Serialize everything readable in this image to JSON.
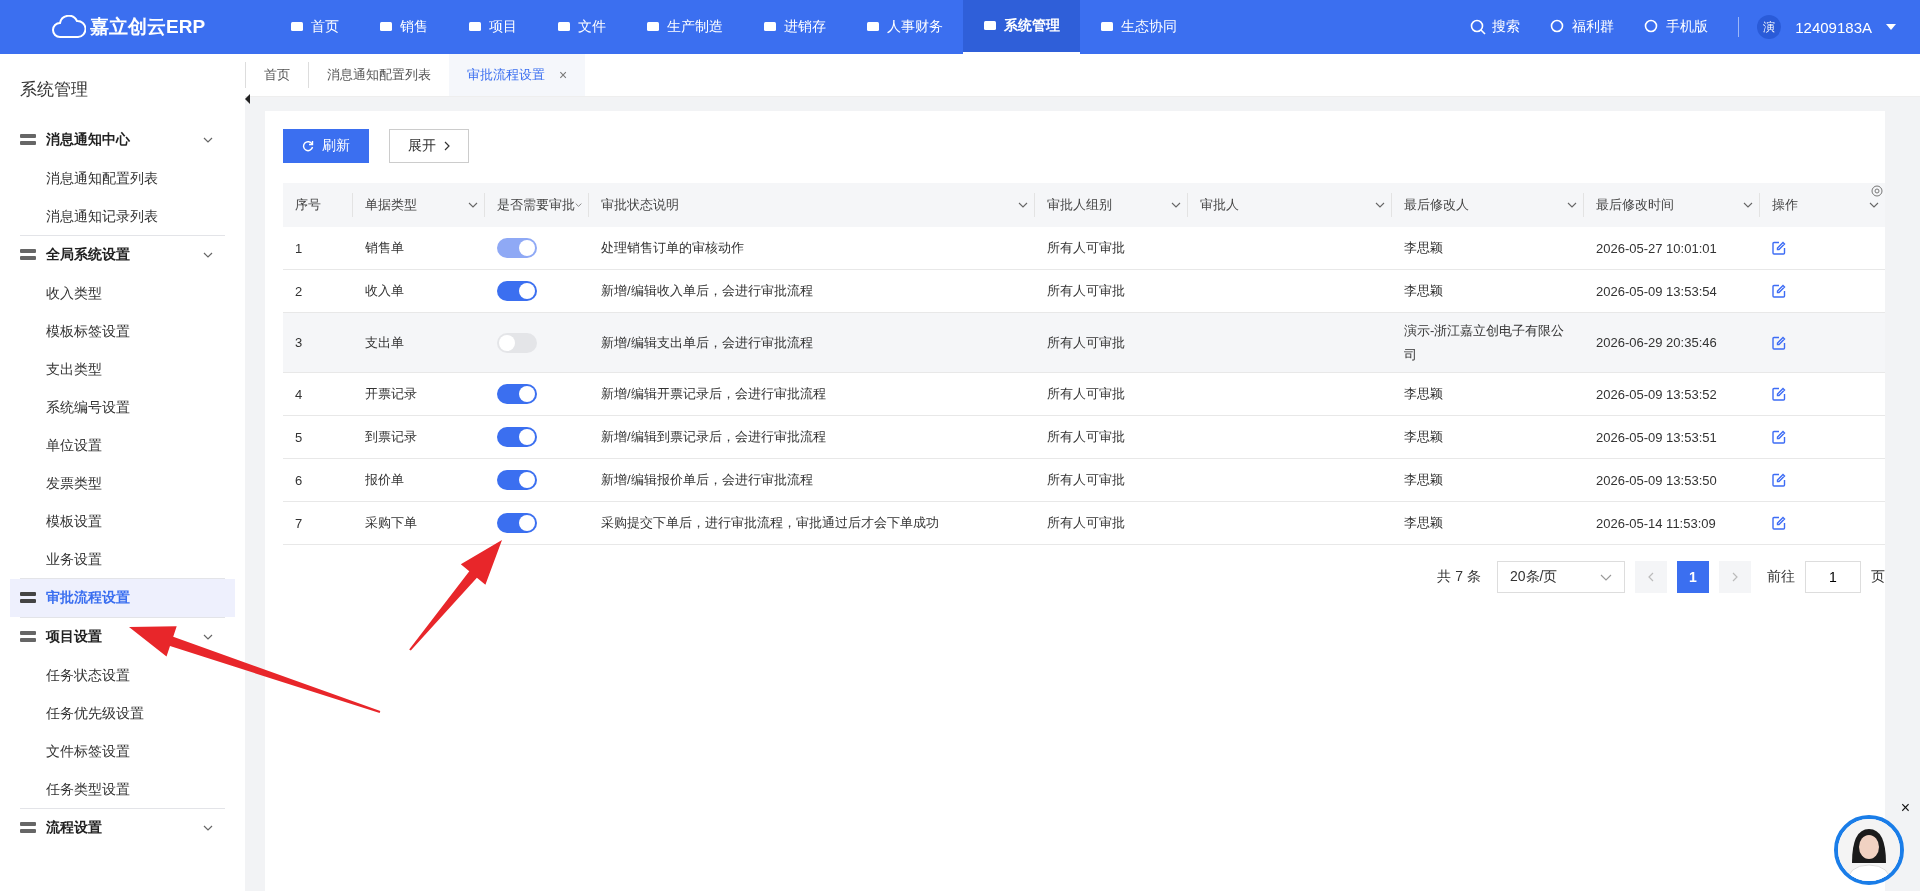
{
  "topbar": {
    "logo": "嘉立创云ERP",
    "nav": [
      {
        "label": "首页",
        "selected": false
      },
      {
        "label": "销售",
        "selected": false
      },
      {
        "label": "项目",
        "selected": false
      },
      {
        "label": "文件",
        "selected": false
      },
      {
        "label": "生产制造",
        "selected": false
      },
      {
        "label": "进销存",
        "selected": false
      },
      {
        "label": "人事财务",
        "selected": false
      },
      {
        "label": "系统管理",
        "selected": true
      },
      {
        "label": "生态协同",
        "selected": false
      }
    ],
    "tools": [
      "搜索",
      "福利群",
      "手机版"
    ],
    "avatar": "演",
    "user": "12409183A"
  },
  "sidebar": {
    "title": "系统管理",
    "items": [
      {
        "kind": "group",
        "label": "消息通知中心",
        "expanded": true,
        "selected": false,
        "children": [
          {
            "label": "消息通知配置列表",
            "selected": false
          },
          {
            "label": "消息通知记录列表",
            "selected": false
          }
        ]
      },
      {
        "kind": "group",
        "label": "全局系统设置",
        "expanded": true,
        "selected": false,
        "children": [
          {
            "label": "收入类型",
            "selected": false
          },
          {
            "label": "模板标签设置",
            "selected": false
          },
          {
            "label": "支出类型",
            "selected": false
          },
          {
            "label": "系统编号设置",
            "selected": false
          },
          {
            "label": "单位设置",
            "selected": false
          },
          {
            "label": "发票类型",
            "selected": false
          },
          {
            "label": "模板设置",
            "selected": false
          },
          {
            "label": "业务设置",
            "selected": false
          }
        ]
      },
      {
        "kind": "item",
        "label": "审批流程设置",
        "selected": true
      },
      {
        "kind": "group",
        "label": "项目设置",
        "expanded": true,
        "selected": false,
        "children": [
          {
            "label": "任务状态设置",
            "selected": false
          },
          {
            "label": "任务优先级设置",
            "selected": false
          },
          {
            "label": "文件标签设置",
            "selected": false
          },
          {
            "label": "任务类型设置",
            "selected": false
          }
        ]
      },
      {
        "kind": "group",
        "label": "流程设置",
        "expanded": true,
        "selected": false
      }
    ]
  },
  "tabs": [
    {
      "label": "首页",
      "selected": false
    },
    {
      "label": "消息通知配置列表",
      "selected": false
    },
    {
      "label": "审批流程设置",
      "selected": true,
      "closable": true,
      "close": "×"
    }
  ],
  "toolbar": {
    "refresh": "刷新",
    "expand": "展开"
  },
  "table": {
    "columns": [
      "序号",
      "单据类型",
      "是否需要审批",
      "审批状态说明",
      "审批人组别",
      "审批人",
      "最后修改人",
      "最后修改时间",
      "操作"
    ],
    "rows": [
      {
        "no": "1",
        "type": "销售单",
        "on": true,
        "disabled": true,
        "desc": "处理销售订单的审核动作",
        "group": "所有人可审批",
        "modifier": "李思颖",
        "time": "2026-05-27 10:01:01",
        "hovered": false
      },
      {
        "no": "2",
        "type": "收入单",
        "on": true,
        "disabled": false,
        "desc": "新增/编辑收入单后，会进行审批流程",
        "group": "所有人可审批",
        "modifier": "李思颖",
        "time": "2026-05-09 13:53:54",
        "hovered": false
      },
      {
        "no": "3",
        "type": "支出单",
        "on": false,
        "disabled": false,
        "desc": "新增/编辑支出单后，会进行审批流程",
        "group": "所有人可审批",
        "modifier": "演示-浙江嘉立创电子有限公司",
        "time": "2026-06-29 20:35:46",
        "hovered": true
      },
      {
        "no": "4",
        "type": "开票记录",
        "on": true,
        "disabled": false,
        "desc": "新增/编辑开票记录后，会进行审批流程",
        "group": "所有人可审批",
        "modifier": "李思颖",
        "time": "2026-05-09 13:53:52",
        "hovered": false
      },
      {
        "no": "5",
        "type": "到票记录",
        "on": true,
        "disabled": false,
        "desc": "新增/编辑到票记录后，会进行审批流程",
        "group": "所有人可审批",
        "modifier": "李思颖",
        "time": "2026-05-09 13:53:51",
        "hovered": false
      },
      {
        "no": "6",
        "type": "报价单",
        "on": true,
        "disabled": false,
        "desc": "新增/编辑报价单后，会进行审批流程",
        "group": "所有人可审批",
        "modifier": "李思颖",
        "time": "2026-05-09 13:53:50",
        "hovered": false
      },
      {
        "no": "7",
        "type": "采购下单",
        "on": true,
        "disabled": false,
        "desc": "采购提交下单后，进行审批流程，审批通过后才会下单成功",
        "group": "所有人可审批",
        "modifier": "李思颖",
        "time": "2026-05-14 11:53:09",
        "hovered": false
      }
    ]
  },
  "pagination": {
    "total": "共 7 条",
    "page_size": "20条/页",
    "pages": [
      {
        "label": "1",
        "selected": true
      }
    ],
    "goto": "前往",
    "goto_value": "1",
    "page_unit": "页"
  },
  "assistant": {
    "kind": "picture",
    "close": "×"
  }
}
